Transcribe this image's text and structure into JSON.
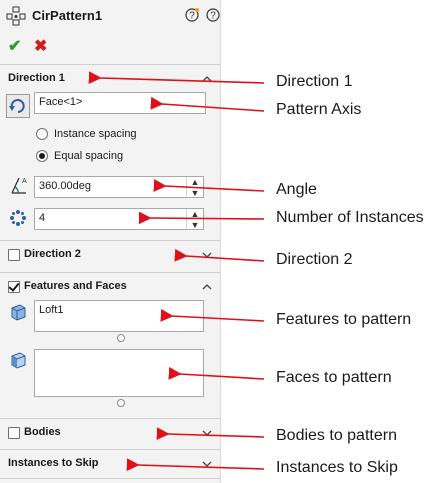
{
  "panel": {
    "title": "CirPattern1",
    "confirm_icon": "checkmark-icon",
    "cancel_icon": "x-icon",
    "direction1": {
      "label": "Direction 1",
      "axis_value": "Face<1>",
      "radio_instance_spacing": "Instance spacing",
      "radio_equal_spacing": "Equal spacing",
      "selected_spacing": "equal",
      "angle_value": "360.00deg",
      "instances_value": "4"
    },
    "direction2": {
      "label": "Direction 2",
      "checked": false
    },
    "features_faces": {
      "label": "Features and Faces",
      "checked": true,
      "features_list": [
        "Loft1"
      ],
      "faces_list": []
    },
    "bodies": {
      "label": "Bodies",
      "checked": false
    },
    "instances_to_skip": {
      "label": "Instances to Skip"
    }
  },
  "annotations": [
    "Direction 1",
    "Pattern Axis",
    "Angle",
    "Number of Instances",
    "Direction 2",
    "Features to pattern",
    "Faces to pattern",
    "Bodies to pattern",
    "Instances to Skip"
  ],
  "colors": {
    "arrow": "#e0101a",
    "ok": "#2f9a2f",
    "cancel": "#d11c1c",
    "panel_bg": "#f3f3f3"
  }
}
